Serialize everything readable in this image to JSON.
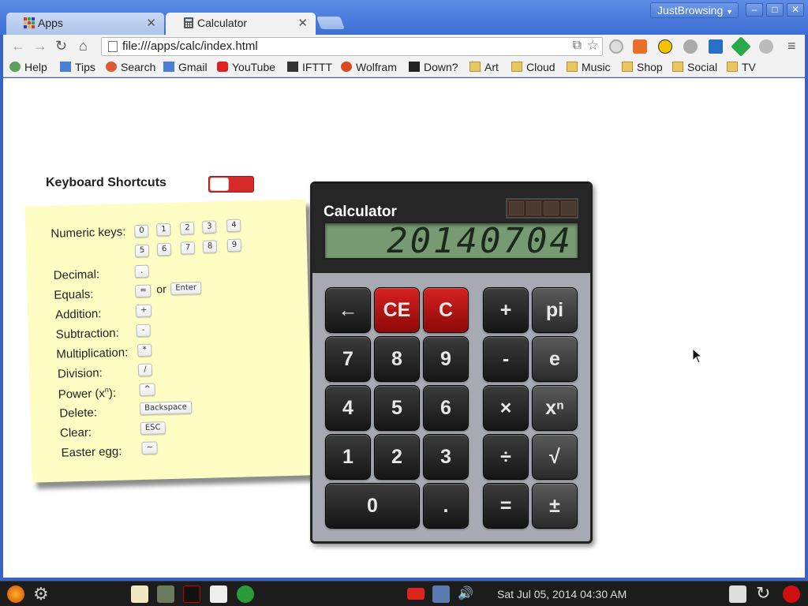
{
  "browser": {
    "tabs": [
      {
        "title": "Apps",
        "icon": "apps-grid-icon"
      },
      {
        "title": "Calculator",
        "icon": "calculator-icon"
      }
    ],
    "profile": "JustBrowsing",
    "url": "file:///apps/calc/index.html",
    "bookmarks": [
      "Help",
      "Tips",
      "Search",
      "Gmail",
      "YouTube",
      "IFTTT",
      "Wolfram",
      "Down?",
      "Art",
      "Cloud",
      "Music",
      "Shop",
      "Social",
      "TV"
    ]
  },
  "shortcuts": {
    "title": "Keyboard Shortcuts",
    "toggle_on": false,
    "rows": [
      {
        "label": "Numeric keys:",
        "keys": [
          "0",
          "1",
          "2",
          "3",
          "4",
          "5",
          "6",
          "7",
          "8",
          "9"
        ]
      },
      {
        "label": "Decimal:",
        "keys": [
          "."
        ]
      },
      {
        "label": "Equals:",
        "keys": [
          "=",
          "Enter"
        ],
        "joiner": "or"
      },
      {
        "label": "Addition:",
        "keys": [
          "+"
        ]
      },
      {
        "label": "Subtraction:",
        "keys": [
          "-"
        ]
      },
      {
        "label": "Multiplication:",
        "keys": [
          "*"
        ]
      },
      {
        "label": "Division:",
        "keys": [
          "/"
        ]
      },
      {
        "label": "Power (x",
        "sup": "n",
        "label_end": "):",
        "keys": [
          "^"
        ]
      },
      {
        "label": "Delete:",
        "keys": [
          "Backspace"
        ]
      },
      {
        "label": "Clear:",
        "keys": [
          "ESC"
        ]
      },
      {
        "label": "Easter egg:",
        "keys": [
          "~"
        ]
      }
    ]
  },
  "calculator": {
    "title": "Calculator",
    "display": "20140704",
    "buttons": [
      [
        "←",
        "CE",
        "C",
        "+",
        "pi"
      ],
      [
        "7",
        "8",
        "9",
        "-",
        "e"
      ],
      [
        "4",
        "5",
        "6",
        "×",
        "xⁿ"
      ],
      [
        "1",
        "2",
        "3",
        "÷",
        "√"
      ],
      [
        "0",
        ".",
        "=",
        "±"
      ]
    ]
  },
  "taskbar": {
    "clock": "Sat Jul 05, 2014  04:30 AM"
  }
}
